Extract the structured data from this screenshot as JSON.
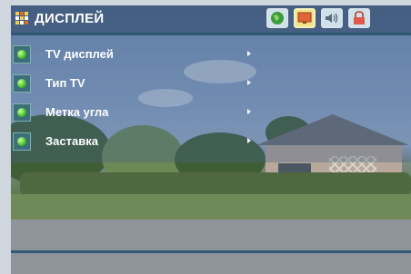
{
  "header": {
    "title": "ДИСПЛЕЙ",
    "title_icon": "settings-grid-icon",
    "tabs": [
      {
        "icon": "globe-icon",
        "active": false
      },
      {
        "icon": "display-icon",
        "active": true
      },
      {
        "icon": "speaker-icon",
        "active": false
      },
      {
        "icon": "lock-icon",
        "active": false
      }
    ]
  },
  "menu": {
    "items": [
      {
        "label": "TV дисплей"
      },
      {
        "label": "Тип TV"
      },
      {
        "label": "Метка угла"
      },
      {
        "label": "Заставка"
      }
    ]
  },
  "colors": {
    "accent": "#2e5b73",
    "bullet": "#45c12a",
    "active_tab": "#f1e58a"
  }
}
